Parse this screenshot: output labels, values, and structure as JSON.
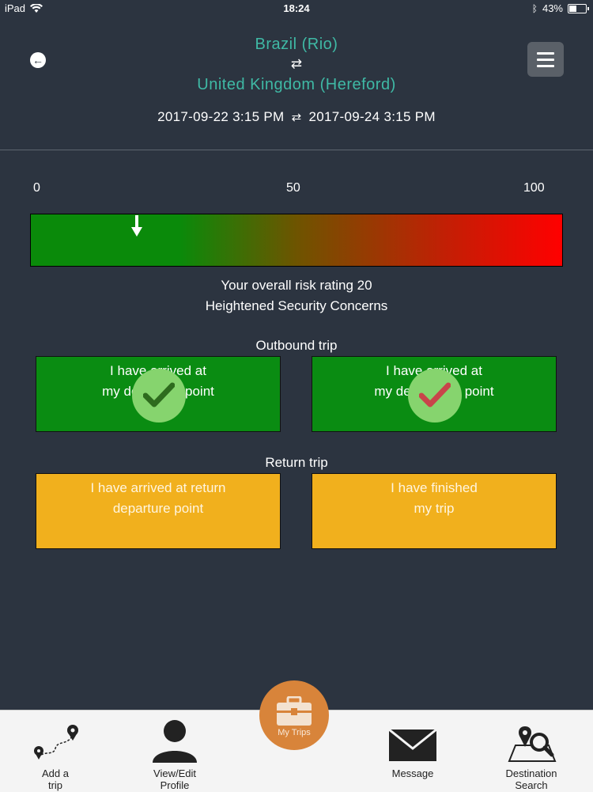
{
  "status_bar": {
    "device": "iPad",
    "time": "18:24",
    "battery": "43%"
  },
  "header": {
    "origin": "Brazil (Rio)",
    "destination": "United Kingdom (Hereford)",
    "swap_symbol": "⇄",
    "depart_datetime": "2017-09-22 3:15 PM",
    "return_datetime": "2017-09-24 3:15 PM"
  },
  "risk_scale": {
    "ticks": [
      "0",
      "50",
      "100"
    ],
    "rating": 20,
    "rating_text": "Your overall risk rating 20",
    "level_text": "Heightened Security Concerns",
    "colors": {
      "low": "#0a8a0a",
      "high": "#ff0000"
    }
  },
  "outbound": {
    "label": "Outbound trip",
    "tiles": [
      {
        "line1": "I have arrived at",
        "line2": "my departure point",
        "checked": true,
        "check_color": "#2e6b1e"
      },
      {
        "line1": "I have arrived at",
        "line2": "my destination point",
        "checked": true,
        "check_color": "#c8454a"
      }
    ]
  },
  "return_trip": {
    "label": "Return trip",
    "tiles": [
      {
        "line1": "I have arrived at return",
        "line2": "departure point"
      },
      {
        "line1": "I have finished",
        "line2": "my trip"
      }
    ]
  },
  "bottom_nav": {
    "add_trip": "Add a\ntrip",
    "view_profile": "View/Edit\nProfile",
    "my_trips": "My Trips",
    "message": "Message",
    "destination_search": "Destination\nSearch"
  },
  "accent_color": "#3fb9a5"
}
